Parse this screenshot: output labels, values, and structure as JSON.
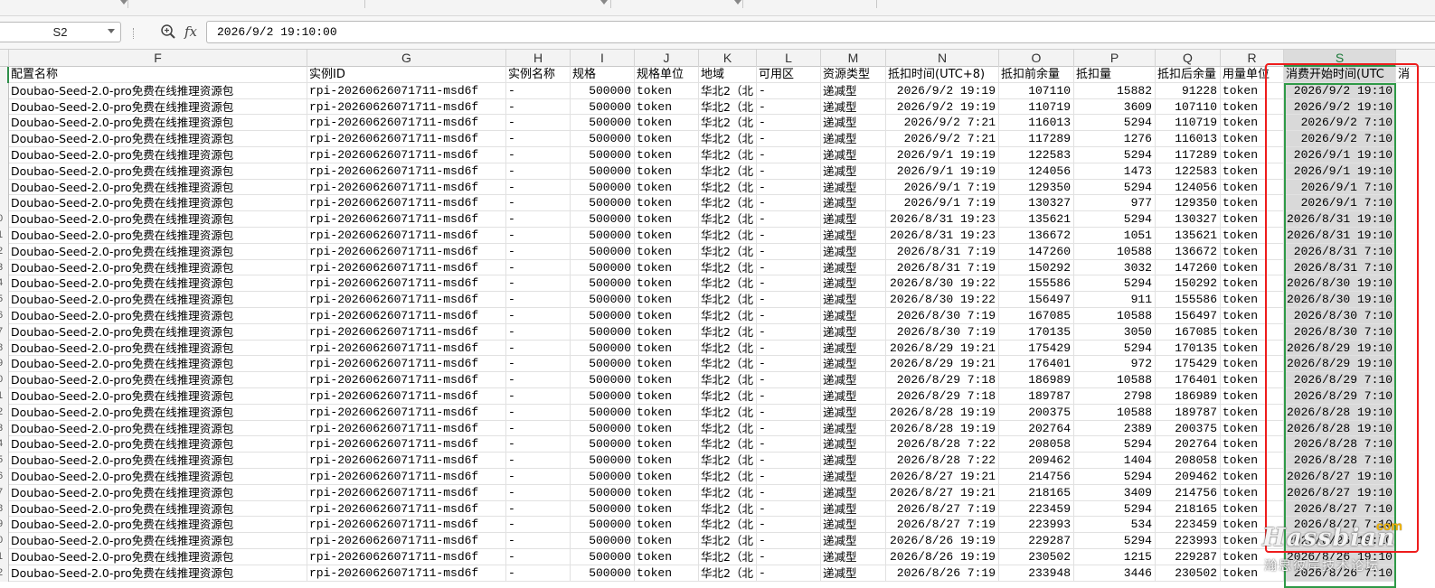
{
  "name_box": {
    "value": "S2"
  },
  "formula_bar": {
    "fx_label": "fx",
    "value": "2026/9/2 19:10:00"
  },
  "columns": [
    {
      "letter": "F",
      "selected": false
    },
    {
      "letter": "G",
      "selected": false
    },
    {
      "letter": "H",
      "selected": false
    },
    {
      "letter": "I",
      "selected": false
    },
    {
      "letter": "J",
      "selected": false
    },
    {
      "letter": "K",
      "selected": false
    },
    {
      "letter": "L",
      "selected": false
    },
    {
      "letter": "M",
      "selected": false
    },
    {
      "letter": "N",
      "selected": false
    },
    {
      "letter": "O",
      "selected": false
    },
    {
      "letter": "P",
      "selected": false
    },
    {
      "letter": "Q",
      "selected": false
    },
    {
      "letter": "R",
      "selected": false
    },
    {
      "letter": "S",
      "selected": true
    }
  ],
  "table": {
    "headers": [
      "配置名称",
      "实例ID",
      "实例名称",
      "规格",
      "规格单位",
      "地域",
      "可用区",
      "资源类型",
      "抵扣时间(UTC+8)",
      "抵扣前余量",
      "抵扣量",
      "抵扣后余量",
      "用量单位",
      "消费开始时间(UTC",
      "消"
    ],
    "constants": {
      "config_name": "Doubao-Seed-2.0-pro免费在线推理资源包",
      "instance_id": "rpi-20260626071711-msd6f",
      "instance_name": "-",
      "spec": "500000",
      "spec_unit": "token",
      "region": "华北2（北",
      "zone": "-",
      "resource_type": "递减型",
      "usage_unit": "token"
    },
    "row_number_fragments": [
      "",
      "",
      "",
      "",
      "",
      "",
      "",
      "",
      "",
      "0",
      "1",
      "2",
      "3",
      "4",
      "5",
      "6",
      "7",
      "8",
      "9",
      "0",
      "1",
      "2",
      "3",
      "4",
      "5",
      "6",
      "7",
      "8",
      "9",
      "0",
      "1",
      "2"
    ],
    "rows": [
      [
        "2026/9/2 19:19",
        "107110",
        "15882",
        "91228",
        "2026/9/2 19:10"
      ],
      [
        "2026/9/2 19:19",
        "110719",
        "3609",
        "107110",
        "2026/9/2 19:10"
      ],
      [
        "2026/9/2 7:21",
        "116013",
        "5294",
        "110719",
        "2026/9/2 7:10"
      ],
      [
        "2026/9/2 7:21",
        "117289",
        "1276",
        "116013",
        "2026/9/2 7:10"
      ],
      [
        "2026/9/1 19:19",
        "122583",
        "5294",
        "117289",
        "2026/9/1 19:10"
      ],
      [
        "2026/9/1 19:19",
        "124056",
        "1473",
        "122583",
        "2026/9/1 19:10"
      ],
      [
        "2026/9/1 7:19",
        "129350",
        "5294",
        "124056",
        "2026/9/1 7:10"
      ],
      [
        "2026/9/1 7:19",
        "130327",
        "977",
        "129350",
        "2026/9/1 7:10"
      ],
      [
        "2026/8/31 19:23",
        "135621",
        "5294",
        "130327",
        "2026/8/31 19:10"
      ],
      [
        "2026/8/31 19:23",
        "136672",
        "1051",
        "135621",
        "2026/8/31 19:10"
      ],
      [
        "2026/8/31 7:19",
        "147260",
        "10588",
        "136672",
        "2026/8/31 7:10"
      ],
      [
        "2026/8/31 7:19",
        "150292",
        "3032",
        "147260",
        "2026/8/31 7:10"
      ],
      [
        "2026/8/30 19:22",
        "155586",
        "5294",
        "150292",
        "2026/8/30 19:10"
      ],
      [
        "2026/8/30 19:22",
        "156497",
        "911",
        "155586",
        "2026/8/30 19:10"
      ],
      [
        "2026/8/30 7:19",
        "167085",
        "10588",
        "156497",
        "2026/8/30 7:10"
      ],
      [
        "2026/8/30 7:19",
        "170135",
        "3050",
        "167085",
        "2026/8/30 7:10"
      ],
      [
        "2026/8/29 19:21",
        "175429",
        "5294",
        "170135",
        "2026/8/29 19:10"
      ],
      [
        "2026/8/29 19:21",
        "176401",
        "972",
        "175429",
        "2026/8/29 19:10"
      ],
      [
        "2026/8/29 7:18",
        "186989",
        "10588",
        "176401",
        "2026/8/29 7:10"
      ],
      [
        "2026/8/29 7:18",
        "189787",
        "2798",
        "186989",
        "2026/8/29 7:10"
      ],
      [
        "2026/8/28 19:19",
        "200375",
        "10588",
        "189787",
        "2026/8/28 19:10"
      ],
      [
        "2026/8/28 19:19",
        "202764",
        "2389",
        "200375",
        "2026/8/28 19:10"
      ],
      [
        "2026/8/28 7:22",
        "208058",
        "5294",
        "202764",
        "2026/8/28 7:10"
      ],
      [
        "2026/8/28 7:22",
        "209462",
        "1404",
        "208058",
        "2026/8/28 7:10"
      ],
      [
        "2026/8/27 19:21",
        "214756",
        "5294",
        "209462",
        "2026/8/27 19:10"
      ],
      [
        "2026/8/27 19:21",
        "218165",
        "3409",
        "214756",
        "2026/8/27 19:10"
      ],
      [
        "2026/8/27 7:19",
        "223459",
        "5294",
        "218165",
        "2026/8/27 7:10"
      ],
      [
        "2026/8/27 7:19",
        "223993",
        "534",
        "223459",
        "2026/8/27 7:10"
      ],
      [
        "2026/8/26 19:19",
        "229287",
        "5294",
        "223993",
        "2026/8/26 19:10"
      ],
      [
        "2026/8/26 19:19",
        "230502",
        "1215",
        "229287",
        "2026/8/26 19:10"
      ],
      [
        "2026/8/26 7:19",
        "233948",
        "3446",
        "230502",
        "2026/8/26 7:10"
      ]
    ]
  },
  "watermark": {
    "brand": "Hassbian",
    "dotcom": "com",
    "subtitle": "瀚思彼岸技术论坛"
  },
  "colors": {
    "selection": "#2f9a47",
    "highlight": "#ee1c1c",
    "header_bg": "#f3f3f3",
    "selected_bg": "#d9d9d9"
  },
  "icons": {
    "zoom": "zoom-magnifier-icon",
    "dropdown": "chevron-down-icon"
  }
}
